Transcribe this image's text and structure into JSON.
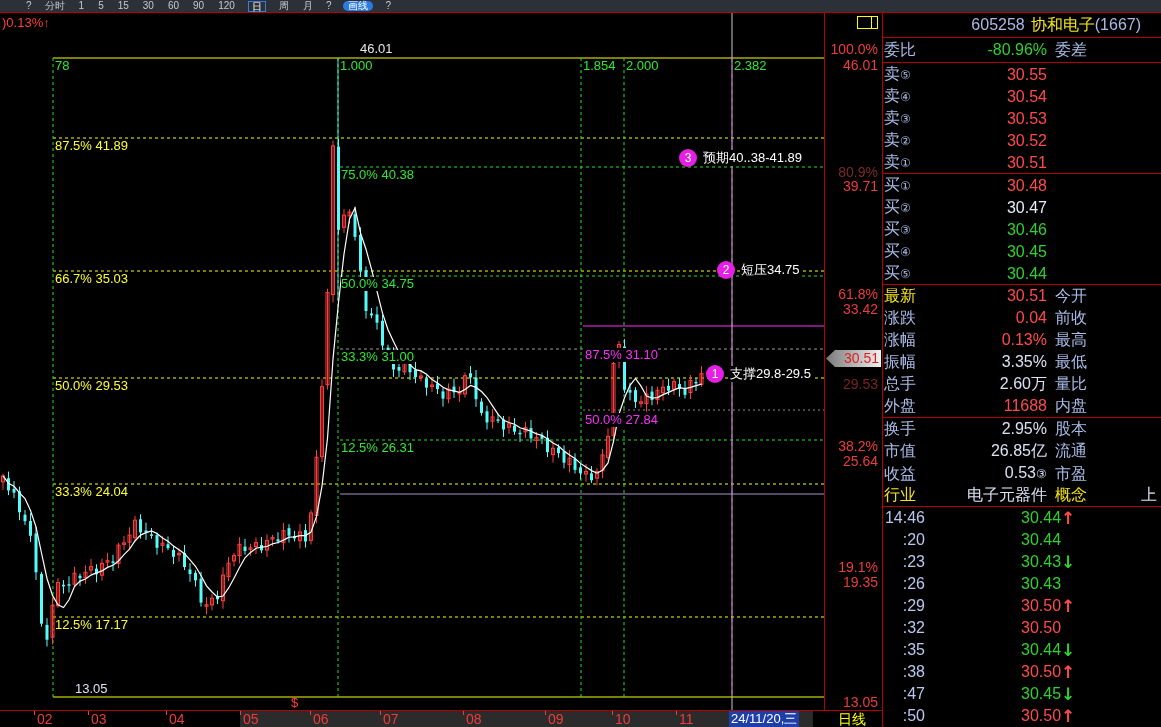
{
  "toolbar": {
    "items": [
      {
        "kind": "mark",
        "label": "?"
      },
      {
        "kind": "period",
        "label": "分时",
        "selected": false
      },
      {
        "kind": "period",
        "label": "1",
        "selected": false
      },
      {
        "kind": "period",
        "label": "5",
        "selected": false
      },
      {
        "kind": "period",
        "label": "15",
        "selected": false
      },
      {
        "kind": "period",
        "label": "30",
        "selected": false
      },
      {
        "kind": "period",
        "label": "60",
        "selected": false
      },
      {
        "kind": "period",
        "label": "90",
        "selected": false
      },
      {
        "kind": "period",
        "label": "120",
        "selected": false
      },
      {
        "kind": "period",
        "label": "日",
        "selected": true
      },
      {
        "kind": "period",
        "label": "周",
        "selected": false
      },
      {
        "kind": "period",
        "label": "月",
        "selected": false
      },
      {
        "kind": "mark",
        "label": "?"
      },
      {
        "kind": "pill",
        "label": "画线",
        "selected": true
      },
      {
        "kind": "mark",
        "label": "?"
      }
    ]
  },
  "chart": {
    "change_readout": ")0.13%↑",
    "time_ratios": [
      "78",
      "1.000",
      "1.854",
      "2.000",
      "2.382"
    ],
    "high_label": "46.01",
    "low_label": "13.05",
    "fib_primary": [
      "87.5% 41.89",
      "66.7% 35.03",
      "50.0% 29.53",
      "33.3% 24.04",
      "12.5% 17.17"
    ],
    "fib_secondary": [
      "75.0% 40.38",
      "50.0% 34.75",
      "33.3% 31.00",
      "12.5% 26.31"
    ],
    "fib_tertiary": [
      "87.5% 31.10",
      "50.0% 27.84"
    ],
    "annotations": [
      {
        "number": "3",
        "text": "预期40..38-41.89"
      },
      {
        "number": "2",
        "text": "短压34.75"
      },
      {
        "number": "1",
        "text": "支撑29.8-29.5"
      }
    ],
    "event_marker": "$"
  },
  "price_axis": {
    "levels": [
      {
        "percent": "100.0%",
        "price": "46.01",
        "dimmed": false
      },
      {
        "percent": "80.9%",
        "price": "39.71",
        "dimmed": true
      },
      {
        "percent": "61.8%",
        "price": "33.42",
        "dimmed": false
      },
      {
        "percent": "38.2%",
        "price": "25.64",
        "dimmed": false
      },
      {
        "percent": "19.1%",
        "price": "19.35",
        "dimmed": false
      }
    ],
    "current_price": "30.51",
    "reference_price": "29.53",
    "bottom_price": "13.05"
  },
  "time_axis": {
    "months": [
      "02",
      "03",
      "04",
      "05",
      "06",
      "07",
      "08",
      "09",
      "10",
      "11"
    ],
    "cursor_date": "24/11/20,三",
    "period": "日线"
  },
  "quote": {
    "code": "605258",
    "name": "协和电子",
    "count": "(1667)",
    "order_ratio": {
      "label": "委比",
      "value": "-80.96%",
      "color": "#2ed12e",
      "label2": "委差"
    },
    "asks": [
      {
        "label": "卖",
        "index": "⑤",
        "price": "30.55",
        "color": "#ff4a4a"
      },
      {
        "label": "卖",
        "index": "④",
        "price": "30.54",
        "color": "#ff4a4a"
      },
      {
        "label": "卖",
        "index": "③",
        "price": "30.53",
        "color": "#ff4a4a"
      },
      {
        "label": "卖",
        "index": "②",
        "price": "30.52",
        "color": "#ff4a4a"
      },
      {
        "label": "卖",
        "index": "①",
        "price": "30.51",
        "color": "#ff4a4a"
      }
    ],
    "bids": [
      {
        "label": "买",
        "index": "①",
        "price": "30.48",
        "color": "#ff4a4a"
      },
      {
        "label": "买",
        "index": "②",
        "price": "30.47",
        "color": "#e6ecf8"
      },
      {
        "label": "买",
        "index": "③",
        "price": "30.46",
        "color": "#2ed12e"
      },
      {
        "label": "买",
        "index": "④",
        "price": "30.45",
        "color": "#2ed12e"
      },
      {
        "label": "买",
        "index": "⑤",
        "price": "30.44",
        "color": "#2ed12e"
      }
    ],
    "stats": [
      {
        "label": {
          "text": "最新",
          "highlighted": true
        },
        "value": "30.51",
        "color": "#ff4a4a",
        "label2": {
          "text": "今开",
          "highlighted": false
        }
      },
      {
        "label": {
          "text": "涨跌",
          "highlighted": false
        },
        "value": "0.04",
        "color": "#ff4a4a",
        "label2": {
          "text": "前收",
          "highlighted": false
        }
      },
      {
        "label": {
          "text": "涨幅",
          "highlighted": false
        },
        "value": "0.13%",
        "color": "#ff4a4a",
        "label2": {
          "text": "最高",
          "highlighted": false
        }
      },
      {
        "label": {
          "text": "振幅",
          "highlighted": false
        },
        "value": "3.35%",
        "color": "#d9e1f2",
        "label2": {
          "text": "最低",
          "highlighted": false
        }
      },
      {
        "label": {
          "text": "总手",
          "highlighted": false
        },
        "value": "2.60万",
        "color": "#d9e1f2",
        "label2": {
          "text": "量比",
          "highlighted": false
        }
      },
      {
        "label": {
          "text": "外盘",
          "highlighted": false
        },
        "value": "11688",
        "color": "#ff4a4a",
        "label2": {
          "text": "内盘",
          "highlighted": false
        }
      }
    ],
    "fundamentals": [
      {
        "label": {
          "text": "换手",
          "highlighted": false
        },
        "value": "2.95%",
        "color": "#d9e1f2",
        "label2": {
          "text": "股本",
          "highlighted": false
        }
      },
      {
        "label": {
          "text": "市值",
          "highlighted": false
        },
        "value": "26.85亿",
        "color": "#d9e1f2",
        "label2": {
          "text": "流通",
          "highlighted": false
        }
      },
      {
        "label": {
          "text": "收益",
          "highlighted": false
        },
        "value": "0.53",
        "suffix": "③",
        "color": "#d9e1f2",
        "label2": {
          "text": "市盈",
          "highlighted": false
        }
      },
      {
        "label": {
          "text": "行业",
          "highlighted": true
        },
        "value": "电子元器件",
        "color": "#d9e1f2",
        "label2": {
          "text": "概念",
          "highlighted": true
        },
        "value2": "上"
      }
    ],
    "ticks": [
      {
        "time": "14:46",
        "price": "30.44",
        "color": "#2ed12e",
        "arrow": {
          "text": "↑",
          "color": "#ff4a4a"
        }
      },
      {
        "time": ":20",
        "price": "30.44",
        "color": "#2ed12e"
      },
      {
        "time": ":23",
        "price": "30.43",
        "color": "#2ed12e",
        "arrow": {
          "text": "↓",
          "color": "#2ed12e"
        }
      },
      {
        "time": ":26",
        "price": "30.43",
        "color": "#2ed12e"
      },
      {
        "time": ":29",
        "price": "30.50",
        "color": "#ff4a4a",
        "arrow": {
          "text": "↑",
          "color": "#ff4a4a"
        }
      },
      {
        "time": ":32",
        "price": "30.50",
        "color": "#ff4a4a"
      },
      {
        "time": ":35",
        "price": "30.44",
        "color": "#2ed12e",
        "arrow": {
          "text": "↓",
          "color": "#2ed12e"
        }
      },
      {
        "time": ":38",
        "price": "30.50",
        "color": "#ff4a4a",
        "arrow": {
          "text": "↑",
          "color": "#ff4a4a"
        }
      },
      {
        "time": ":47",
        "price": "30.45",
        "color": "#2ed12e",
        "arrow": {
          "text": "↓",
          "color": "#2ed12e"
        }
      },
      {
        "time": ":50",
        "price": "30.50",
        "color": "#ff4a4a",
        "arrow": {
          "text": "↑",
          "color": "#ff4a4a"
        }
      }
    ]
  }
}
